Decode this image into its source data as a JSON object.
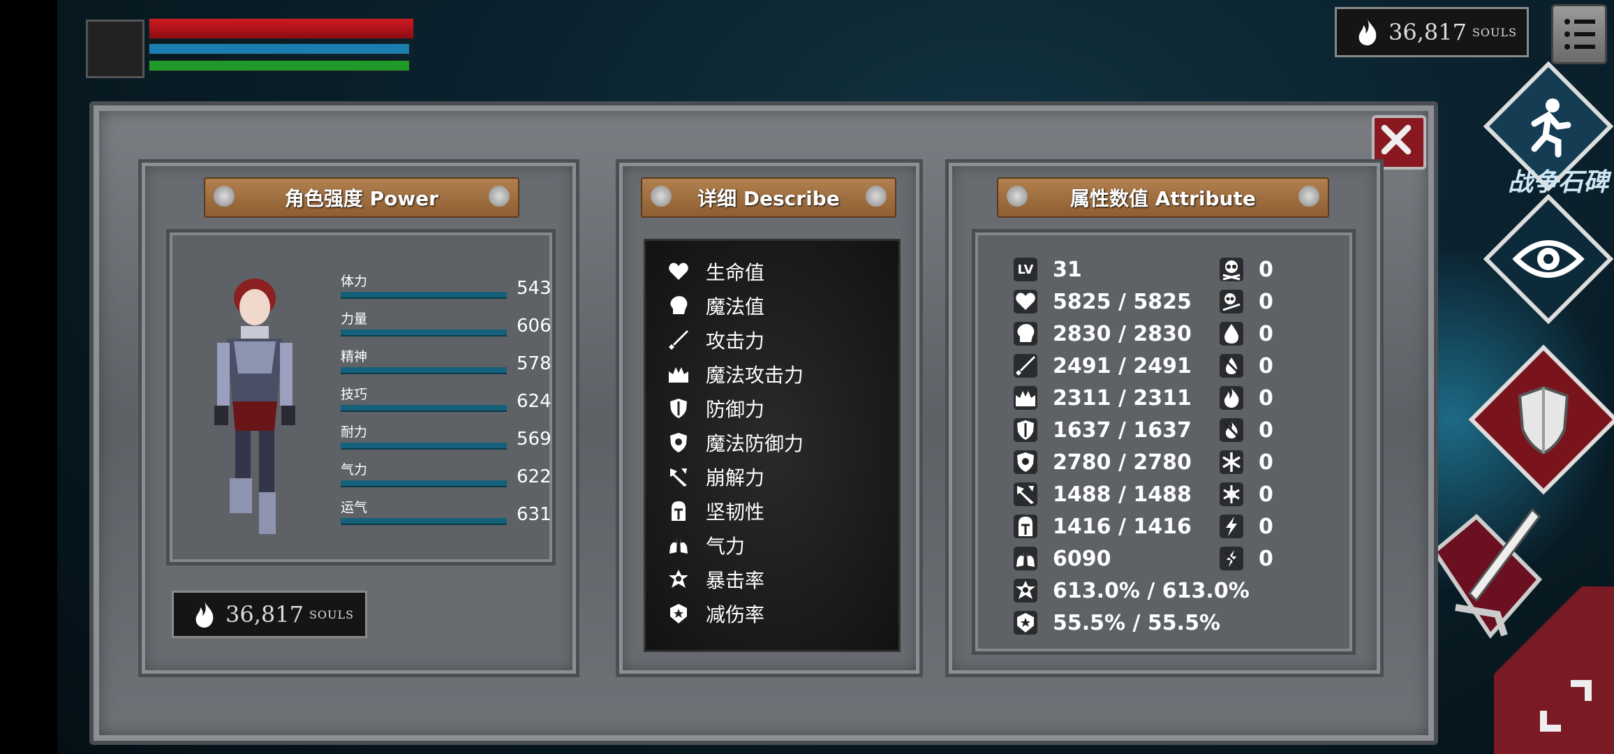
{
  "hud": {
    "souls_value": "36,817",
    "souls_label": "SOULS",
    "side_label": "战争石碑"
  },
  "panels": {
    "power_title": "角色强度 Power",
    "describe_title": "详细 Describe",
    "attribute_title": "属性数值 Attribute"
  },
  "stats": [
    {
      "name": "体力",
      "value": "543"
    },
    {
      "name": "力量",
      "value": "606"
    },
    {
      "name": "精神",
      "value": "578"
    },
    {
      "name": "技巧",
      "value": "624"
    },
    {
      "name": "耐力",
      "value": "569"
    },
    {
      "name": "气力",
      "value": "622"
    },
    {
      "name": "运气",
      "value": "631"
    }
  ],
  "power_souls": {
    "value": "36,817",
    "label": "SOULS"
  },
  "describe": [
    {
      "icon": "heart-icon",
      "label": "生命值"
    },
    {
      "icon": "mind-icon",
      "label": "魔法值"
    },
    {
      "icon": "sword-icon",
      "label": "攻击力"
    },
    {
      "icon": "magic-attack-icon",
      "label": "魔法攻击力"
    },
    {
      "icon": "shield-icon",
      "label": "防御力"
    },
    {
      "icon": "magic-shield-icon",
      "label": "魔法防御力"
    },
    {
      "icon": "break-icon",
      "label": "崩解力"
    },
    {
      "icon": "helmet-icon",
      "label": "坚韧性"
    },
    {
      "icon": "lungs-icon",
      "label": "气力"
    },
    {
      "icon": "star-icon",
      "label": "暴击率"
    },
    {
      "icon": "badge-icon",
      "label": "减伤率"
    }
  ],
  "attributes_left": [
    {
      "icon": "level-icon",
      "icon_text": "LV",
      "value": "31"
    },
    {
      "icon": "heart-icon",
      "value": "5825 / 5825"
    },
    {
      "icon": "mind-icon",
      "value": "2830 / 2830"
    },
    {
      "icon": "sword-icon",
      "value": "2491 / 2491"
    },
    {
      "icon": "magic-attack-icon",
      "value": "2311 / 2311"
    },
    {
      "icon": "shield-icon",
      "value": "1637 / 1637"
    },
    {
      "icon": "magic-shield-icon",
      "value": "2780 / 2780"
    },
    {
      "icon": "break-icon",
      "value": "1488 / 1488"
    },
    {
      "icon": "helmet-icon",
      "value": "1416 / 1416"
    },
    {
      "icon": "lungs-icon",
      "value": "6090"
    },
    {
      "icon": "star-icon",
      "value": "613.0% / 613.0%"
    },
    {
      "icon": "badge-icon",
      "value": "55.5% / 55.5%"
    }
  ],
  "attributes_right": [
    {
      "icon": "skull-icon",
      "value": "0"
    },
    {
      "icon": "skull-resist-icon",
      "value": "0"
    },
    {
      "icon": "drop-icon",
      "value": "0"
    },
    {
      "icon": "drop-resist-icon",
      "value": "0"
    },
    {
      "icon": "fire-icon",
      "value": "0"
    },
    {
      "icon": "fire-resist-icon",
      "value": "0"
    },
    {
      "icon": "frost-icon",
      "value": "0"
    },
    {
      "icon": "frost-resist-icon",
      "value": "0"
    },
    {
      "icon": "lightning-icon",
      "value": "0"
    },
    {
      "icon": "lightning-resist-icon",
      "value": "0"
    }
  ],
  "colors": {
    "health": "#b01018",
    "mana": "#1a7fb0",
    "stamina": "#1f9a2a",
    "stat_bar": "#15607a"
  }
}
